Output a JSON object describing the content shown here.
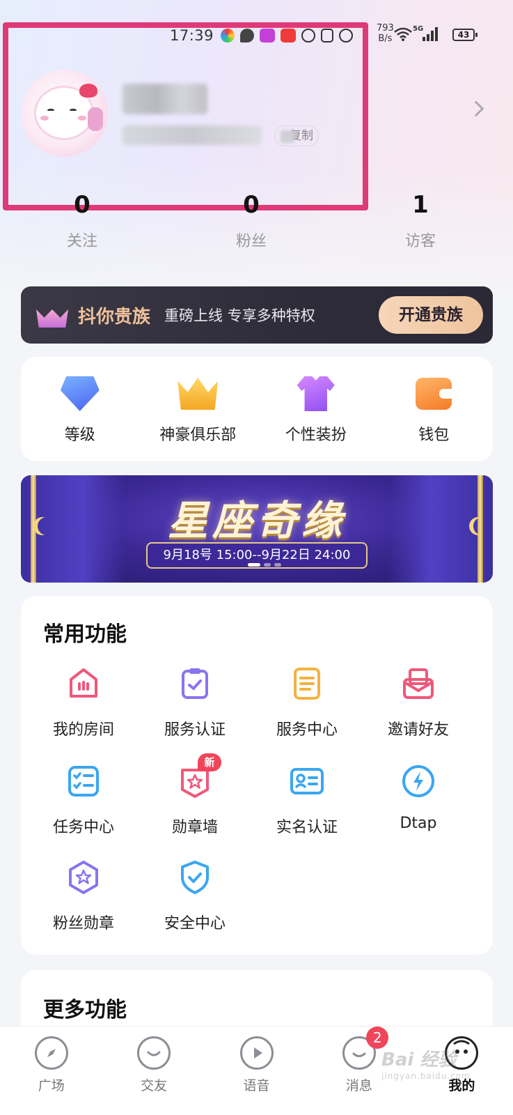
{
  "status_bar": {
    "time": "17:39",
    "net_speed_value": "793",
    "net_speed_unit": "B/s",
    "network": "5G",
    "battery": "43"
  },
  "profile": {
    "copy_label": "复制"
  },
  "stats": [
    {
      "value": "0",
      "label": "关注"
    },
    {
      "value": "0",
      "label": "粉丝"
    },
    {
      "value": "1",
      "label": "访客"
    }
  ],
  "noble": {
    "title": "抖你贵族",
    "desc": "重磅上线 专享多种特权",
    "button": "开通贵族"
  },
  "quick": [
    {
      "label": "等级",
      "icon": "level-icon"
    },
    {
      "label": "神豪俱乐部",
      "icon": "crown-icon"
    },
    {
      "label": "个性装扮",
      "icon": "shirt-icon"
    },
    {
      "label": "钱包",
      "icon": "wallet-icon"
    }
  ],
  "event": {
    "title": "星座奇缘",
    "date": "9月18号 15:00--9月22日 24:00"
  },
  "common": {
    "title": "常用功能",
    "items": [
      {
        "label": "我的房间",
        "icon": "room-icon",
        "color": "#f0577a"
      },
      {
        "label": "服务认证",
        "icon": "clipboard-check-icon",
        "color": "#8c73f0"
      },
      {
        "label": "服务中心",
        "icon": "document-icon",
        "color": "#f3b33d"
      },
      {
        "label": "邀请好友",
        "icon": "envelope-icon",
        "color": "#f0577a"
      },
      {
        "label": "任务中心",
        "icon": "task-list-icon",
        "color": "#3aa6f2"
      },
      {
        "label": "勋章墙",
        "icon": "medal-star-icon",
        "color": "#f0577a",
        "badge": "新"
      },
      {
        "label": "实名认证",
        "icon": "id-card-icon",
        "color": "#3aa6f2"
      },
      {
        "label": "Dtap",
        "icon": "lightning-icon",
        "color": "#3aa6f2"
      },
      {
        "label": "粉丝勋章",
        "icon": "fan-badge-icon",
        "color": "#8c73f0"
      },
      {
        "label": "安全中心",
        "icon": "shield-check-icon",
        "color": "#3aa6f2"
      }
    ]
  },
  "more": {
    "title": "更多功能"
  },
  "tabs": [
    {
      "label": "广场",
      "icon": "compass-icon"
    },
    {
      "label": "交友",
      "icon": "heart-icon"
    },
    {
      "label": "语音",
      "icon": "play-icon"
    },
    {
      "label": "消息",
      "icon": "chat-icon",
      "badge": "2"
    },
    {
      "label": "我的",
      "icon": "mine-icon",
      "active": true
    }
  ],
  "watermark": {
    "brand": "Bai 经验",
    "url": "jingyan.baidu.com"
  },
  "colors": {
    "accent": "#de3a78",
    "noble_gold": "#f0c19a",
    "badge_red": "#f0455b"
  }
}
